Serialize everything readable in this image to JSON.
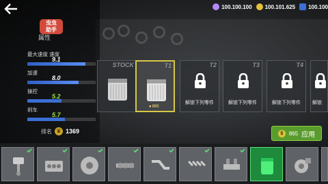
{
  "currency": [
    {
      "icon": "gear-coin-icon",
      "value": "100.100.100"
    },
    {
      "icon": "gold-coin-icon",
      "value": "100.101.625"
    },
    {
      "icon": "cash-icon",
      "value": "100.100"
    }
  ],
  "badge": "虫虫\n助手",
  "attr_title": "属性",
  "stats": [
    {
      "label": "最大速度 速度",
      "value": "9.1",
      "level": 0.85
    },
    {
      "label": "加速",
      "value": "8.0",
      "level": 0.75
    },
    {
      "label": "操控",
      "value": "5.2",
      "level": 0.5
    },
    {
      "label": "刹车",
      "value": "5.7",
      "level": 0.55
    }
  ],
  "rank": {
    "label": "排名",
    "value": "1369"
  },
  "cards": [
    {
      "tag": "STOCK",
      "type": "filter",
      "price": ""
    },
    {
      "tag": "T1",
      "type": "filter",
      "price": "865",
      "selected": true
    },
    {
      "tag": "T2",
      "type": "lock",
      "lock_text": "解锁下列零件"
    },
    {
      "tag": "T3",
      "type": "lock",
      "lock_text": "解锁下列零件"
    },
    {
      "tag": "T4",
      "type": "lock",
      "lock_text": "解锁下列零件"
    },
    {
      "tag": "",
      "type": "lock",
      "lock_text": "解锁"
    }
  ],
  "apply": {
    "cost": "865",
    "label": "应用"
  },
  "parts": [
    "piston-icon",
    "engine-block-icon",
    "flywheel-icon",
    "camshaft-icon",
    "exhaust-icon",
    "injector-icon",
    "intake-icon",
    "air-filter-icon",
    "turbo-icon"
  ],
  "colors": {
    "accent_green": "#5a9b2d",
    "selected_border": "#d9c848",
    "stat_blue": "#3b6fd4",
    "stat_red": "#d23a3a"
  }
}
